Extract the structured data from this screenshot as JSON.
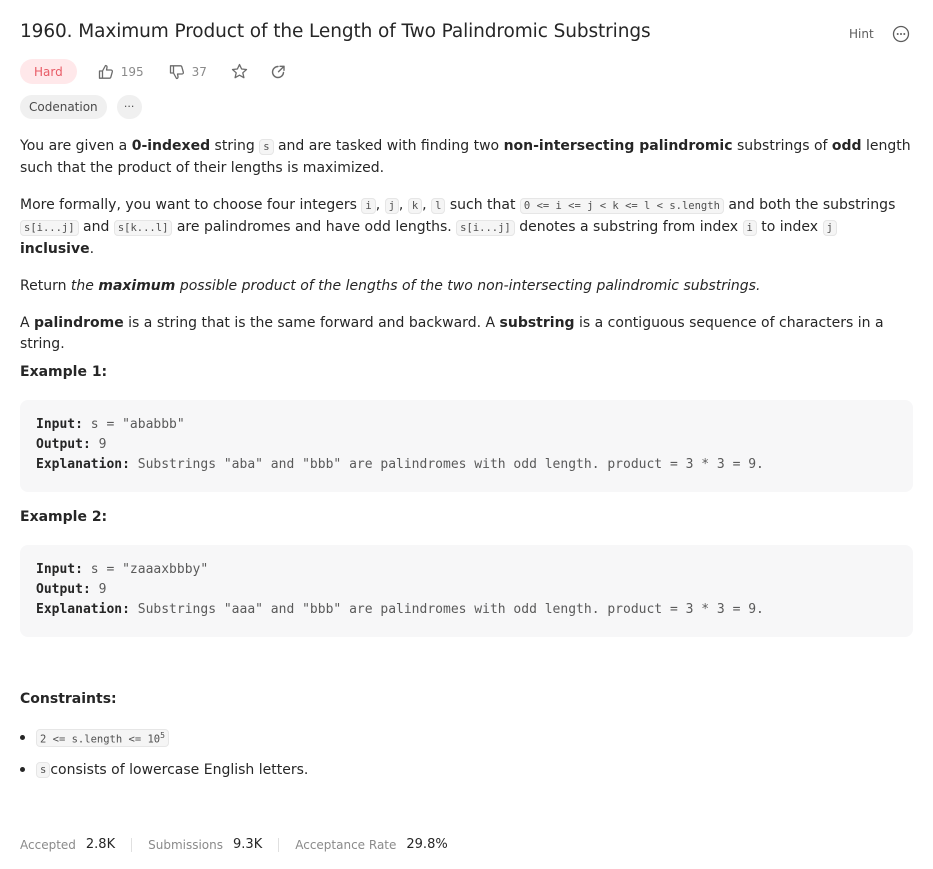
{
  "problem": {
    "title": "1960. Maximum Product of the Length of Two Palindromic Substrings",
    "hint_label": "Hint",
    "difficulty": "Hard",
    "likes": "195",
    "dislikes": "37",
    "company_tag": "Codenation",
    "more_label": "···"
  },
  "description": {
    "p1": [
      "You are given a ",
      "0-indexed",
      " string ",
      "s",
      " and are tasked with finding two ",
      "non-intersecting palindromic",
      " substrings of ",
      "odd",
      " length such that the product of their lengths is maximized."
    ],
    "p2": [
      "More formally, you want to choose four integers ",
      "i",
      ", ",
      "j",
      ", ",
      "k",
      ", ",
      "l",
      " such that ",
      "0 <= i <= j < k <= l < s.length",
      " and both the substrings ",
      "s[i...j]",
      " and ",
      "s[k...l]",
      " are palindromes and have odd lengths. ",
      "s[i...j]",
      " denotes a substring from index ",
      "i",
      " to index ",
      "j",
      " ",
      "inclusive",
      "."
    ],
    "p3": [
      "Return ",
      "the ",
      "maximum",
      " possible product of the lengths of the two non-intersecting palindromic substrings."
    ],
    "p4": [
      "A ",
      "palindrome",
      " is a string that is the same forward and backward. A ",
      "substring",
      " is a contiguous sequence of characters in a string."
    ]
  },
  "examples": [
    {
      "title": "Example 1:",
      "input_label": "Input:",
      "input": " s = \"ababbb\"",
      "output_label": "Output:",
      "output": " 9",
      "explanation_label": "Explanation:",
      "explanation": " Substrings \"aba\" and \"bbb\" are palindromes with odd length. product = 3 * 3 = 9."
    },
    {
      "title": "Example 2:",
      "input_label": "Input:",
      "input": " s = \"zaaaxbbby\"",
      "output_label": "Output:",
      "output": " 9",
      "explanation_label": "Explanation:",
      "explanation": " Substrings \"aaa\" and \"bbb\" are palindromes with odd length. product = 3 * 3 = 9."
    }
  ],
  "constraints": {
    "title": "Constraints:",
    "c1_code": "2 <= s.length <= 10",
    "c1_sup": "5",
    "c2_code": "s",
    "c2_text": " consists of lowercase English letters."
  },
  "footer": {
    "accepted_label": "Accepted",
    "accepted": "2.8K",
    "submissions_label": "Submissions",
    "submissions": "9.3K",
    "rate_label": "Acceptance Rate",
    "rate": "29.8%"
  }
}
